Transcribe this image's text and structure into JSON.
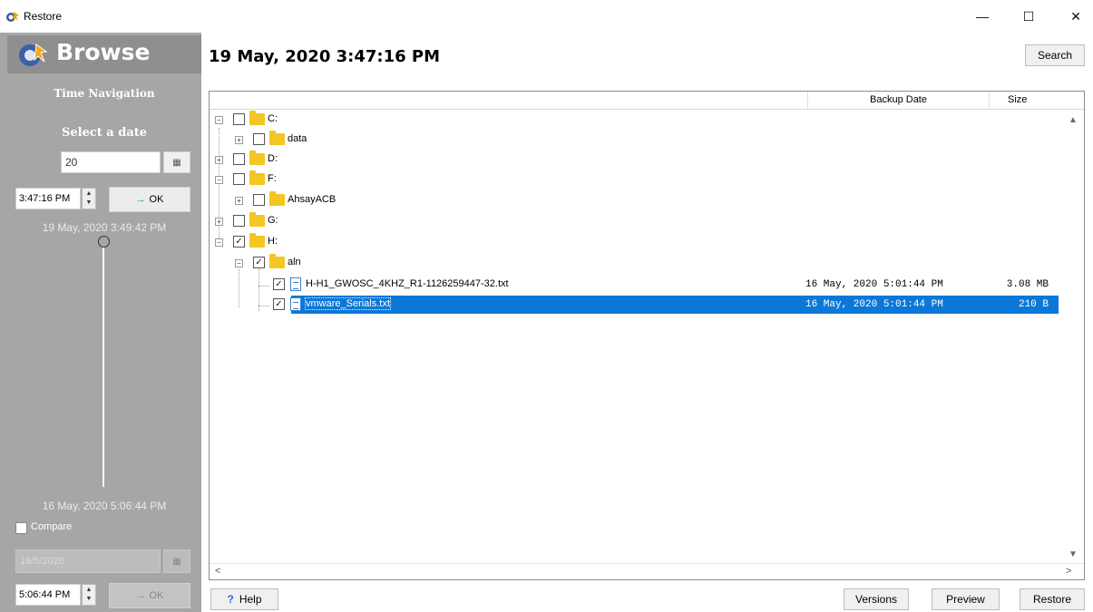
{
  "window": {
    "title": "Restore",
    "minimize_label": "—",
    "maximize_label": "☐",
    "close_label": "✕"
  },
  "left_panel": {
    "header": "Browse",
    "section_title": "Time Navigation",
    "select_date_label": "Select a date",
    "date_value": "20",
    "time_value": "3:47:16 PM",
    "ok_label": "OK",
    "slider_top_time": "19 May, 2020 3:49:42 PM",
    "slider_bottom_time": "16 May, 2020 5:06:44 PM",
    "compare_label": "Compare",
    "compare_checked": false,
    "compare_date_value": "16/5/2020",
    "compare_time_value": "5:06:44 PM",
    "compare_ok_label": "OK"
  },
  "main": {
    "current_date": "19 May, 2020 3:47:16 PM",
    "search_label": "Search",
    "columns": {
      "name": "",
      "backup_date": "Backup Date",
      "size": "Size"
    },
    "tree": [
      {
        "label": "C:",
        "type": "folder",
        "checked": false,
        "expanded": true
      },
      {
        "label": "data",
        "type": "folder",
        "checked": false,
        "expanded": false
      },
      {
        "label": "D:",
        "type": "folder",
        "checked": false,
        "expanded": false
      },
      {
        "label": "F:",
        "type": "folder",
        "checked": false,
        "expanded": true
      },
      {
        "label": "AhsayACB",
        "type": "folder",
        "checked": false,
        "expanded": false
      },
      {
        "label": "G:",
        "type": "folder",
        "checked": false,
        "expanded": false
      },
      {
        "label": "H:",
        "type": "folder",
        "checked": true,
        "expanded": true
      },
      {
        "label": "aln",
        "type": "folder",
        "checked": true,
        "expanded": true
      },
      {
        "label": "H-H1_GWOSC_4KHZ_R1-1126259447-32.txt",
        "type": "file",
        "checked": true,
        "backup_date": "16 May, 2020 5:01:44 PM",
        "size": "3.08 MB"
      },
      {
        "label": "vmware_Serials.txt",
        "type": "file",
        "checked": true,
        "selected": true,
        "backup_date": "16 May, 2020 5:01:44 PM",
        "size": "210 B"
      }
    ]
  },
  "footer": {
    "help_label": "Help",
    "versions_label": "Versions",
    "preview_label": "Preview",
    "restore_label": "Restore"
  },
  "colors": {
    "accent": "#0b78d7",
    "left_panel_bg": "#a6a6a6",
    "folder": "#f3c623"
  }
}
